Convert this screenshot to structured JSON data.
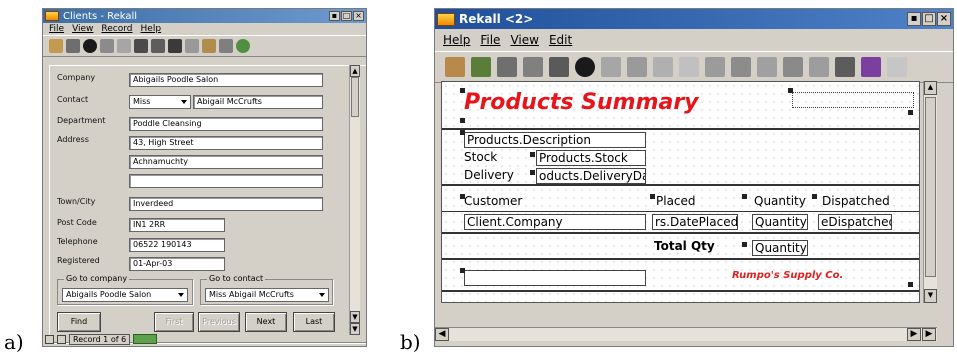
{
  "labels": {
    "a": "a)",
    "b": "b)"
  },
  "left_window": {
    "title": "Clients - Rekall",
    "window_controls": [
      "▪",
      "□",
      "×"
    ],
    "menu": [
      "File",
      "View",
      "Record",
      "Help"
    ],
    "toolbar_icons": [
      "query-icon",
      "print-icon",
      "cancel-icon",
      "first-record-icon",
      "prev-record-icon",
      "insert-record-icon",
      "next-record-icon",
      "new-record-icon",
      "last-record-icon",
      "sort-icon",
      "filter-icon",
      "refresh-icon"
    ],
    "form": {
      "company_label": "Company",
      "company_value": "Abigails Poodle Salon",
      "contact_label": "Contact",
      "contact_title": "Miss",
      "contact_name": "Abigail McCrufts",
      "department_label": "Department",
      "department_value": "Poddle Cleansing",
      "address_label": "Address",
      "address_line1": "43, High Street",
      "address_line2": "Achnamuchty",
      "address_line3": "",
      "town_label": "Town/City",
      "town_value": "Inverdeed",
      "postcode_label": "Post Code",
      "postcode_value": "IN1 2RR",
      "telephone_label": "Telephone",
      "telephone_value": "06522 190143",
      "registered_label": "Registered",
      "registered_value": "01-Apr-03",
      "goto_company_label": "Go to company",
      "goto_company_value": "Abigails Poodle Salon",
      "goto_contact_label": "Go to contact",
      "goto_contact_value": "Miss Abigail McCrufts"
    },
    "buttons": {
      "find": "Find",
      "first": "First",
      "previous": "Previous",
      "next": "Next",
      "last": "Last"
    },
    "status": {
      "record": "Record 1 of 6"
    }
  },
  "right_window": {
    "title": "Rekall <2>",
    "window_controls": [
      "▪",
      "□",
      "×"
    ],
    "menu": [
      "Help",
      "File",
      "View",
      "Edit"
    ],
    "toolbar_icons": [
      "properties-icon",
      "tree-icon",
      "print-icon",
      "preview-icon",
      "save-icon",
      "cancel-icon",
      "cut-icon",
      "copy-icon",
      "paste-icon",
      "label-icon",
      "chart-icon",
      "align-left-icon",
      "align-bottom-icon",
      "grid-icon",
      "columns-icon",
      "field-icon",
      "chart-color-icon",
      "pattern-icon"
    ],
    "report": {
      "title": "Products Summary",
      "detail": {
        "description": "Products.Description",
        "stock_label": "Stock",
        "stock_field": "Products.Stock",
        "delivery_label": "Delivery",
        "delivery_field": "oducts.DeliveryDate"
      },
      "headers": {
        "customer": "Customer",
        "placed": "Placed",
        "quantity": "Quantity",
        "dispatched": "Dispatched"
      },
      "rows": {
        "company": "Client.Company",
        "date_placed": "rs.DatePlaced",
        "quantity": "Quantity",
        "dispatched": "eDispatched"
      },
      "total_label": "Total Qty",
      "total_field": "Quantity",
      "footer_company": "Rumpo's Supply Co."
    }
  },
  "colors": {
    "title_red": "#e8141c",
    "footer_red": "#e02020",
    "window_title_blue": "#2a5ca8"
  }
}
